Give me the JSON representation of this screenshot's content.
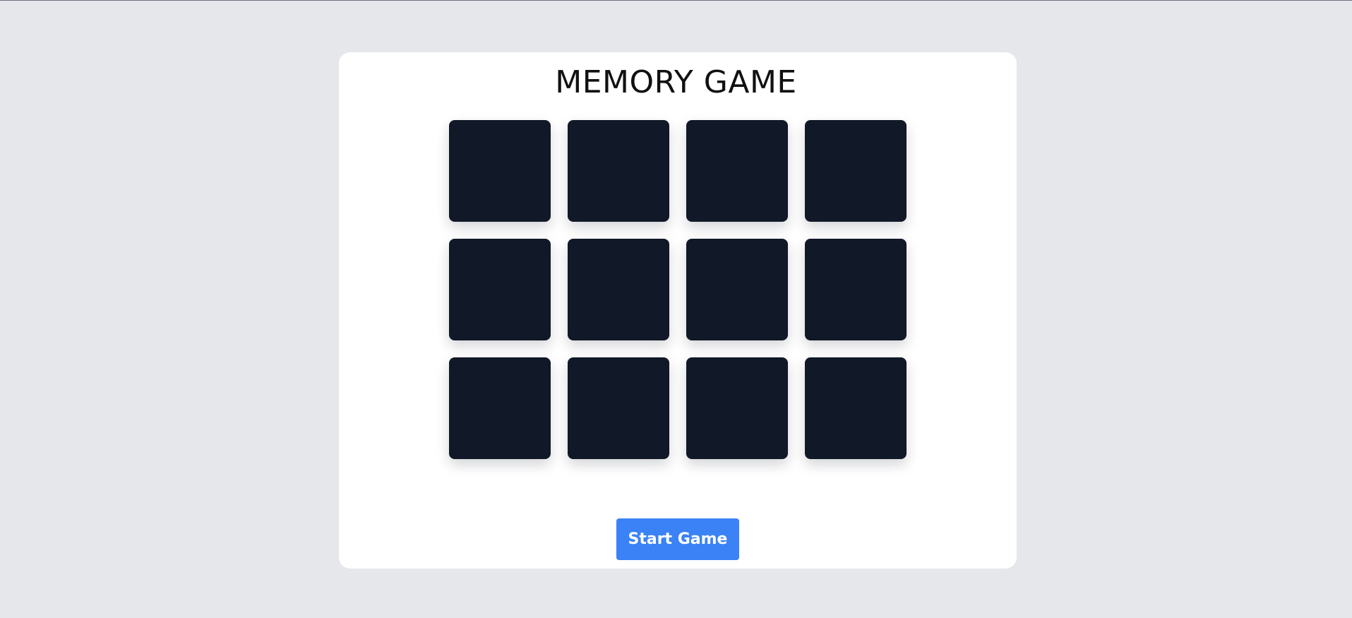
{
  "game": {
    "title": "MEMORY GAME",
    "cards": [
      {
        "state": "face-down"
      },
      {
        "state": "face-down"
      },
      {
        "state": "face-down"
      },
      {
        "state": "face-down"
      },
      {
        "state": "face-down"
      },
      {
        "state": "face-down"
      },
      {
        "state": "face-down"
      },
      {
        "state": "face-down"
      },
      {
        "state": "face-down"
      },
      {
        "state": "face-down"
      },
      {
        "state": "face-down"
      },
      {
        "state": "face-down"
      }
    ],
    "start_button_label": "Start Game"
  },
  "colors": {
    "page_background": "#e5e7eb",
    "panel_background": "#ffffff",
    "card_back": "#111827",
    "accent_button": "#3b82f6",
    "button_text": "#ffffff"
  }
}
